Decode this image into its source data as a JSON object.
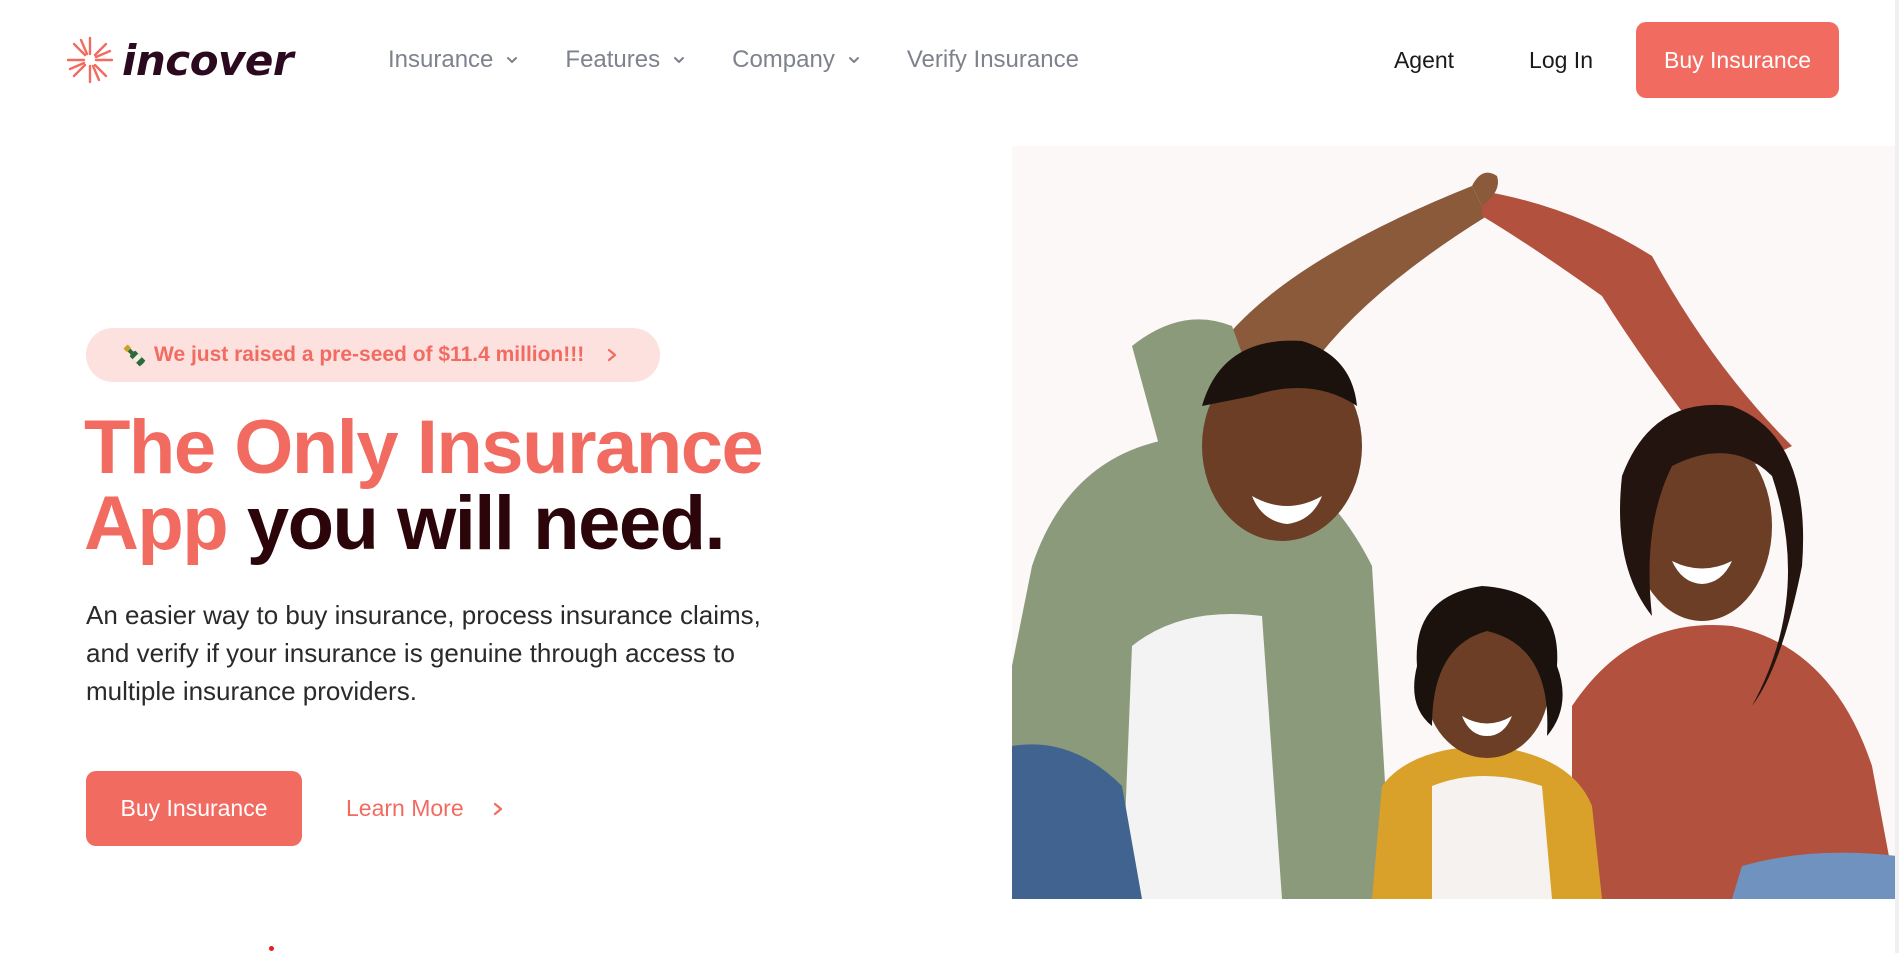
{
  "header": {
    "logo_text": "incover",
    "nav": [
      {
        "label": "Insurance",
        "has_dropdown": true
      },
      {
        "label": "Features",
        "has_dropdown": true
      },
      {
        "label": "Company",
        "has_dropdown": true
      },
      {
        "label": "Verify Insurance",
        "has_dropdown": false
      }
    ],
    "agent_label": "Agent",
    "login_label": "Log In",
    "buy_label": "Buy Insurance"
  },
  "hero": {
    "announcement": "We just raised a pre-seed of $11.4 million!!!",
    "headline_line1": "The Only Insurance",
    "headline_accent": "App",
    "headline_dark": " you will need.",
    "description": "An easier way to buy insurance, process insurance claims, and verify if your insurance is genuine through access to multiple insurance providers.",
    "buy_label": "Buy Insurance",
    "learn_label": "Learn More"
  },
  "colors": {
    "accent": "#f26b61",
    "accent_light": "#fde1df",
    "dark": "#2b0509",
    "nav_gray": "#7d828c"
  },
  "icons": [
    "sparkle-logo-icon",
    "chevron-down-icon",
    "champagne-bottle-icon",
    "chevron-right-icon"
  ]
}
